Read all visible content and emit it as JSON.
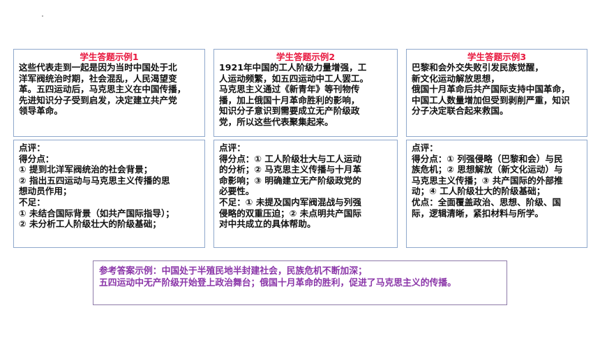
{
  "answers": [
    {
      "title": "学生答题示例1",
      "lines": [
        "这些代表走到一起是因为当时中国处于北",
        "洋军阀统治时期，社会混乱，人民渴望变",
        "革。五四运动后，马克思主义在中国传播，",
        "先进知识分子受到启发，决定建立共产党",
        "领导革命。"
      ]
    },
    {
      "title": "学生答题示例2",
      "lines": [
        "1921年中国的工人阶级力量增强，工",
        "人运动频繁，如五四运动中工人罢工。",
        "马克思主义通过《新青年》等刊物传",
        "播，加上俄国十月革命胜利的影响，",
        "知识分子意识到需要成立无产阶级政",
        "党，所以这些代表聚集起来。"
      ]
    },
    {
      "title": "学生答题示例3",
      "lines": [
        "巴黎和会外交失败引发民族觉醒，",
        "新文化运动解放思想，",
        "俄国十月革命后共产国际支持中国革命，",
        "中国工人数量增加但受到剥削严重，知识",
        "分子决定联合起来救国。"
      ]
    }
  ],
  "comments": [
    {
      "lines": [
        "点评：",
        "得分点：",
        "① 提到北洋军阀统治的社会背景；",
        "② 指出五四运动与马克思主义传播的思",
        "想动员作用；",
        "不足：",
        "① 未结合国际背景（如共产国际指导）；",
        "② 未分析工人阶级壮大的阶级基础；"
      ]
    },
    {
      "lines": [
        "点评：",
        "得分点：① 工人阶级壮大与工人运动",
        "的分析；② 马克思主义传播与十月革",
        "命影响；③ 明确建立无产阶级政党的",
        "必要性。",
        "不足：① 未提及国内军阀混战与列强",
        "侵略的双重压迫；② 未点明共产国际",
        "对中共成立的具体帮助。"
      ]
    },
    {
      "lines": [
        "点评：",
        "得分点：① 列强侵略（巴黎和会）与民",
        "族危机；② 思想解放（新文化运动）与",
        "马克思主义传播；③ 共产国际的外部推",
        "动；④ 工人阶级壮大的阶级基础；",
        "优点：全面覆盖政治、思想、阶级、国",
        "际，逻辑清晰，紧扣材料与所学。"
      ]
    }
  ],
  "reference": {
    "lines": [
      "参考答案示例：中国处于半殖民地半封建社会，民族危机不断加深；",
      "五四运动中无产阶级开始登上政治舞台；俄国十月革命的胜利，促进了马克思主义的传播。"
    ]
  }
}
